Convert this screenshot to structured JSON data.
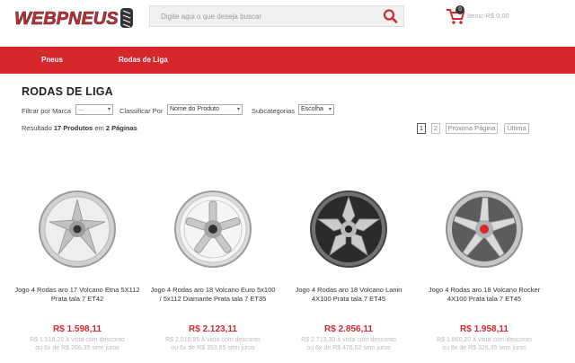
{
  "header": {
    "logo_text": "WEBPNEUS",
    "search_placeholder": "Digite aqui o que deseja buscar",
    "cart_count": "0",
    "cart_text": "Itens: R$ 0,00"
  },
  "nav": {
    "items": [
      "Pneus",
      "Rodas de Liga"
    ]
  },
  "page": {
    "title": "RODAS DE LIGA"
  },
  "filters": {
    "brand_label": "Filtrar por Marca",
    "brand_value": "...",
    "sort_label": "Classificar Por",
    "sort_value": "Nome do Produto",
    "sub_label": "Subcategorias",
    "sub_value": "Escolha"
  },
  "results": {
    "prefix": "Resultado",
    "count": "17 Produtos",
    "middle": "em",
    "pages": "2 Páginas"
  },
  "pagination": [
    "1",
    "2",
    "Próxima Página",
    "Última"
  ],
  "products": [
    {
      "name": "Jogo 4 Rodas aro 17 Volcano Etna 5X112 Prata tala 7 ET42",
      "price": "R$ 1.598,11",
      "cash_line1": "R$ 1.518,20 à vista com desconto",
      "cash_line2": "ou 6x de R$ 266,35 sem juros",
      "accent": "#888888"
    },
    {
      "name": "Jogo 4 Rodas aro 18 Volcano Euro 5x100 / 5x112 Diamante Prata tala 7 ET35",
      "price": "R$ 2.123,11",
      "cash_line1": "R$ 2.016,95 à vista com desconto",
      "cash_line2": "ou 6x de R$ 353,85 sem juros",
      "accent": "#888888"
    },
    {
      "name": "Jogo 4 Rodas aro 18 Volcano Lanin 4X100 Prata tala 7 ET45",
      "price": "R$ 2.856,11",
      "cash_line1": "R$ 2.713,30 à vista com desconto",
      "cash_line2": "ou 6x de R$ 476,02 sem juros",
      "accent": "#222222"
    },
    {
      "name": "Jogo 4 Rodas aro 18 Volcano Rocker 4X100 Prata tala 7 ET45",
      "price": "R$ 1.958,11",
      "cash_line1": "R$ 1.860,20 à vista com desconto",
      "cash_line2": "ou 6x de R$ 326,35 sem juros",
      "accent": "#d6272c"
    }
  ],
  "colors": {
    "brand_red": "#d6272c",
    "text_dark": "#222222"
  }
}
